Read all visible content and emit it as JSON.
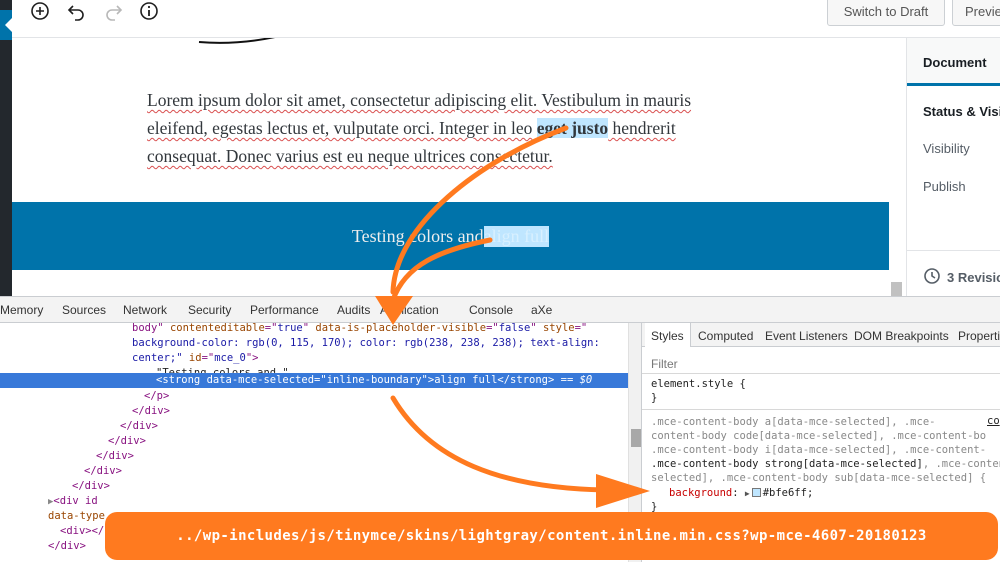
{
  "toolbar": {
    "switch_to_draft": "Switch to Draft",
    "preview": "Previe"
  },
  "editor": {
    "paragraph": {
      "l1_a": "Lorem ipsum dolor sit amet, consectetur adipiscing elit. Vestibulum in mauris",
      "l2_a": "eleifend, egestas lectus et, vulputate orci. Integer in leo ",
      "l2_sel": "eget justo",
      "l2_b": " hendrerit",
      "l3_a": "consequat. Donec varius est eu neque ultrices consectetur."
    },
    "cover": {
      "text_before": "Testing colors and ",
      "text_selected": "align full"
    }
  },
  "sidebar": {
    "document_tab": "Document",
    "status_heading": "Status & Visib",
    "visibility": "Visibility",
    "publish": "Publish",
    "revisions": "3 Revisio"
  },
  "devtools": {
    "tabs": [
      "Memory",
      "Sources",
      "Network",
      "Security",
      "Performance",
      "Audits",
      "Application",
      "Console",
      "aXe"
    ],
    "elements": {
      "l0_a": "body\" ",
      "l0_attr1": "contenteditable",
      "l0_eq1": "=\"",
      "l0_val1": "true",
      "l0_b": "\" ",
      "l0_attr2": "data-is-placeholder-visible",
      "l0_eq2": "=\"",
      "l0_val2": "false",
      "l0_c": "\" ",
      "l0_attr3": "style",
      "l0_eq3": "=\"",
      "l1": "background-color: rgb(0, 115, 170); color: rgb(238, 238, 238); text-align:",
      "l2_a": "center;\" ",
      "l2_attr": "id",
      "l2_eq": "=\"",
      "l2_val": "mce_0",
      "l2_b": "\">",
      "l3": "\"Testing colors and \"",
      "l4_open": "<strong ",
      "l4_attr": "data-mce-selected",
      "l4_eq": "=\"",
      "l4_val": "inline-boundary",
      "l4_mid": "\">",
      "l4_text": "align full",
      "l4_close": "</strong>",
      "l4_eq0": " == $0",
      "l5": "</p>",
      "l6": "</div>",
      "l7": "</div>",
      "l8": "</div>",
      "l9": "</div>",
      "l10": "</div>",
      "l11": "</div>",
      "l12_a": "<div id",
      "l13_a": "data-type",
      "l14_a": "<div></",
      "l15_a": "</div>"
    },
    "styles_tabs": [
      "Styles",
      "Computed",
      "Event Listeners",
      "DOM Breakpoints",
      "Properti"
    ],
    "filter_placeholder": "Filter",
    "element_style_1": "element.style {",
    "element_style_2": "}",
    "rule_l1": ".mce-content-body a[data-mce-selected], .mce-",
    "rule_source": "co",
    "rule_l2": "content-body code[data-mce-selected], .mce-content-bo",
    "rule_l3": ".mce-content-body i[data-mce-selected], .mce-content-",
    "rule_l4_match": ".mce-content-body strong[data-mce-selected]",
    "rule_l4_rest": ", .mce-content-",
    "rule_l5": "selected], .mce-content-body sub[data-mce-selected] {",
    "prop_name": "background",
    "prop_value": "#bfe6ff;",
    "rule_close": "}"
  },
  "callout": "../wp-includes/js/tinymce/skins/lightgray/content.inline.min.css?wp-mce-4607-20180123",
  "colors": {
    "wp_blue": "#0073aa",
    "selection_blue": "#bfe6ff",
    "devtools_selection": "#3879d9",
    "annotation_orange": "#ff7a1f"
  },
  "icons": {
    "add": "plus-circle-icon",
    "undo": "undo-icon",
    "redo": "redo-icon",
    "info": "info-icon",
    "revisions": "history-icon"
  }
}
